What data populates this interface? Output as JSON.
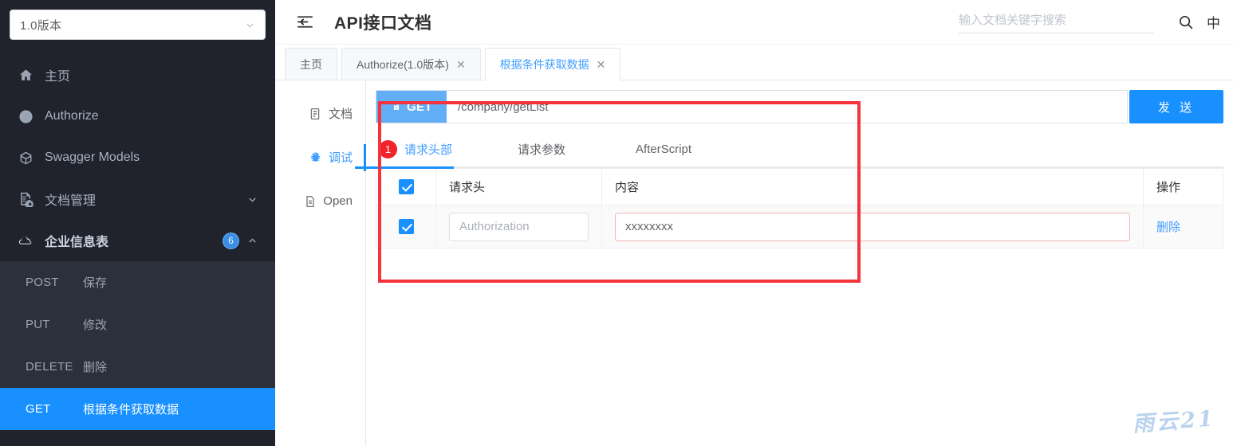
{
  "sidebar": {
    "version_selector": {
      "value": "1.0版本",
      "icon": "chevron-down-icon"
    },
    "nav": [
      {
        "label": "主页",
        "icon": "home-icon"
      },
      {
        "label": "Authorize",
        "icon": "lock-icon"
      },
      {
        "label": "Swagger Models",
        "icon": "cube-icon"
      },
      {
        "label": "文档管理",
        "icon": "document-settings-icon",
        "arrow": "chevron-down-icon"
      },
      {
        "label": "企业信息表",
        "icon": "cloud-icon",
        "badge": "6",
        "arrow": "chevron-up-icon"
      }
    ],
    "endpoints": [
      {
        "method": "POST",
        "name": "保存",
        "active": false
      },
      {
        "method": "PUT",
        "name": "修改",
        "active": false
      },
      {
        "method": "DELETE",
        "name": "删除",
        "active": false
      },
      {
        "method": "GET",
        "name": "根据条件获取数据",
        "active": true
      }
    ]
  },
  "topbar": {
    "menu_icon": "hamburger-icon",
    "title": "API接口文档",
    "search": {
      "placeholder": "输入文档关键字搜索",
      "value": ""
    },
    "search_icon": "search-icon",
    "language": "中"
  },
  "tabs": [
    {
      "label": "主页",
      "closable": false,
      "active": false
    },
    {
      "label": "Authorize(1.0版本)",
      "closable": true,
      "active": false,
      "close": "✕"
    },
    {
      "label": "根据条件获取数据",
      "closable": true,
      "active": true,
      "close": "✕"
    }
  ],
  "vtabs": [
    {
      "label": "文档",
      "icon": "doc-icon",
      "active": false
    },
    {
      "label": "调试",
      "icon": "bug-icon",
      "active": true
    },
    {
      "label": "Open",
      "icon": "file-icon",
      "active": false
    }
  ],
  "request": {
    "method": "GET",
    "method_icon": "unlock-icon",
    "url": "/company/getList",
    "url_placeholder": "",
    "send_label": "发 送"
  },
  "subtabs": [
    {
      "label": "请求头部",
      "count": "1",
      "active": true
    },
    {
      "label": "请求参数",
      "active": false
    },
    {
      "label": "AfterScript",
      "active": false
    }
  ],
  "headers_table": {
    "columns": [
      "请求头",
      "内容",
      "操作"
    ],
    "rows": [
      {
        "enabled": true,
        "key": "",
        "key_placeholder": "Authorization",
        "value": "xxxxxxxx",
        "value_placeholder": "",
        "delete_label": "删除"
      }
    ]
  },
  "watermark": "雨云21",
  "colors": {
    "sidebar_bg": "#20222c",
    "sidebar_sub_bg": "#2b303a",
    "accent_blue": "#1890ff",
    "link_blue": "#409eff",
    "method_chip": "#62aff8",
    "badge_red": "#f1232b",
    "annotation_red": "#f5333a",
    "watermark": "#aecbec"
  }
}
